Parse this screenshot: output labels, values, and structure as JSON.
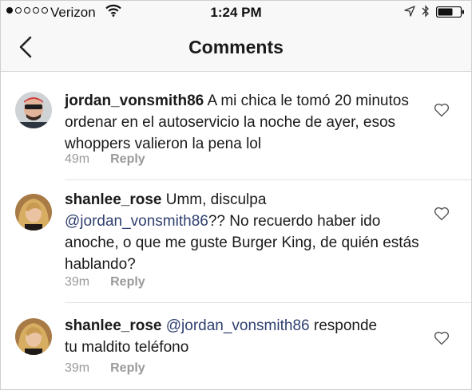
{
  "status_bar": {
    "carrier": "Verizon",
    "time": "1:24 PM",
    "signal_bars_filled": 1,
    "signal_bars_total": 5
  },
  "nav": {
    "title": "Comments",
    "back_icon": "chevron-left-icon"
  },
  "comments": [
    {
      "username": "jordan_vonsmith86",
      "text_before": " A mi chica le tomó 20 minutos ordenar en el autoservicio la noche de ayer, esos whoppers valieron la pena lol",
      "mention": "",
      "text_after": "",
      "time": "49m",
      "reply_label": "Reply"
    },
    {
      "username": "shanlee_rose",
      "text_before": " Umm, disculpa ",
      "mention": "@jordan_vonsmith86",
      "text_after": "?? No recuerdo haber ido anoche, o que me guste Burger King, de quién estás hablando?",
      "time": "39m",
      "reply_label": "Reply"
    },
    {
      "username": "shanlee_rose",
      "text_before": " ",
      "mention": "@jordan_vonsmith86",
      "text_after": " responde tu maldito teléfono",
      "time": "39m",
      "reply_label": "Reply"
    }
  ],
  "colors": {
    "mention": "#2f3f6f",
    "meta": "#9a9a9a",
    "bar_background": "#f8f8f8"
  }
}
